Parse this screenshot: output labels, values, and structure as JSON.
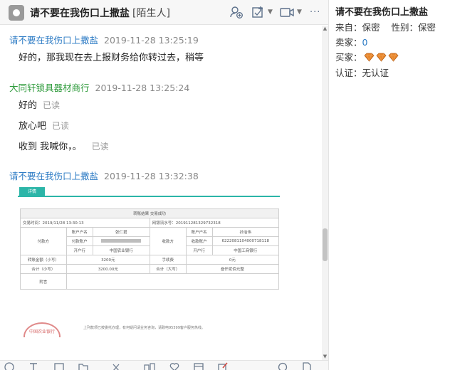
{
  "chat": {
    "title": "请不要在我伤口上撒盐",
    "tag": "[陌生人]",
    "header_icons": [
      "add-contact-icon",
      "screenshot-icon",
      "video-call-icon",
      "more-icon"
    ],
    "more_label": "···"
  },
  "messages": [
    {
      "sender": "请不要在我伤口上撒盐",
      "time": "2019-11-28 13:25:19",
      "sender_color": "#2e7cc5",
      "lines": [
        {
          "text": "好的，那我现在去上报财务给你转过去，稍等",
          "status": ""
        }
      ]
    },
    {
      "sender": "大同轩锁具器材商行",
      "time": "2019-11-28 13:25:24",
      "sender_color": "#2f9b3c",
      "lines": [
        {
          "text": "好的",
          "status": "已读"
        },
        {
          "text": "放心吧",
          "status": "已读"
        },
        {
          "text": "收到 我喊你，。",
          "status": "已读"
        }
      ]
    },
    {
      "sender": "请不要在我伤口上撒盐",
      "time": "2019-11-28 13:32:38",
      "sender_color": "#2e7cc5",
      "lines": []
    }
  ],
  "receipt": {
    "tab": "详情",
    "header": "转账结果 交易成功",
    "trade_time_label": "交易时间：2019/11/28 13:30:13",
    "serial_label": "网银流水号：20191128132973231​8",
    "payer_section": "付款方",
    "payee_section": "收款方",
    "account_name_label": "账户户名",
    "payer_name": "张仁君",
    "payee_name": "孙治伟",
    "account_no_label": "付款账户",
    "payee_account_label": "收款账户",
    "payee_account": "6222081104000718118",
    "bank_label": "开户行",
    "payer_bank": "中国农业银行",
    "payee_bank": "中国工商银行",
    "amount_small_label": "转账金额（小写）",
    "amount_small": "3200元",
    "fee_label": "手续费",
    "fee": "0元",
    "total_small_label": "合计（小写）",
    "total_small": "3200.00元",
    "total_big_label": "合计（大写）",
    "total_big": "叁仟贰佰元整",
    "remark_label": "附言",
    "seal_text": "中国农业银行",
    "note": "上列款项已按委托办理，有何疑问请业务咨询，请致电95599客户服务热线。"
  },
  "toolbar": {
    "icons": [
      "emoji-icon",
      "font-icon",
      "image-icon",
      "folder-icon",
      "scissors-icon",
      "tools-icon",
      "heart-icon",
      "history-icon",
      "edit-icon",
      "search-icon",
      "file-icon"
    ]
  },
  "info": {
    "title": "请不要在我伤口上撒盐",
    "from_label": "来自：",
    "from_value": "保密",
    "gender_label": "性别：",
    "gender_value": "保密",
    "seller_label": "卖家：",
    "seller_value": "0",
    "buyer_label": "买家：",
    "buyer_gems": 3,
    "verify_label": "认证：",
    "verify_value": "无认证",
    "gem_color": "#e8862a"
  }
}
